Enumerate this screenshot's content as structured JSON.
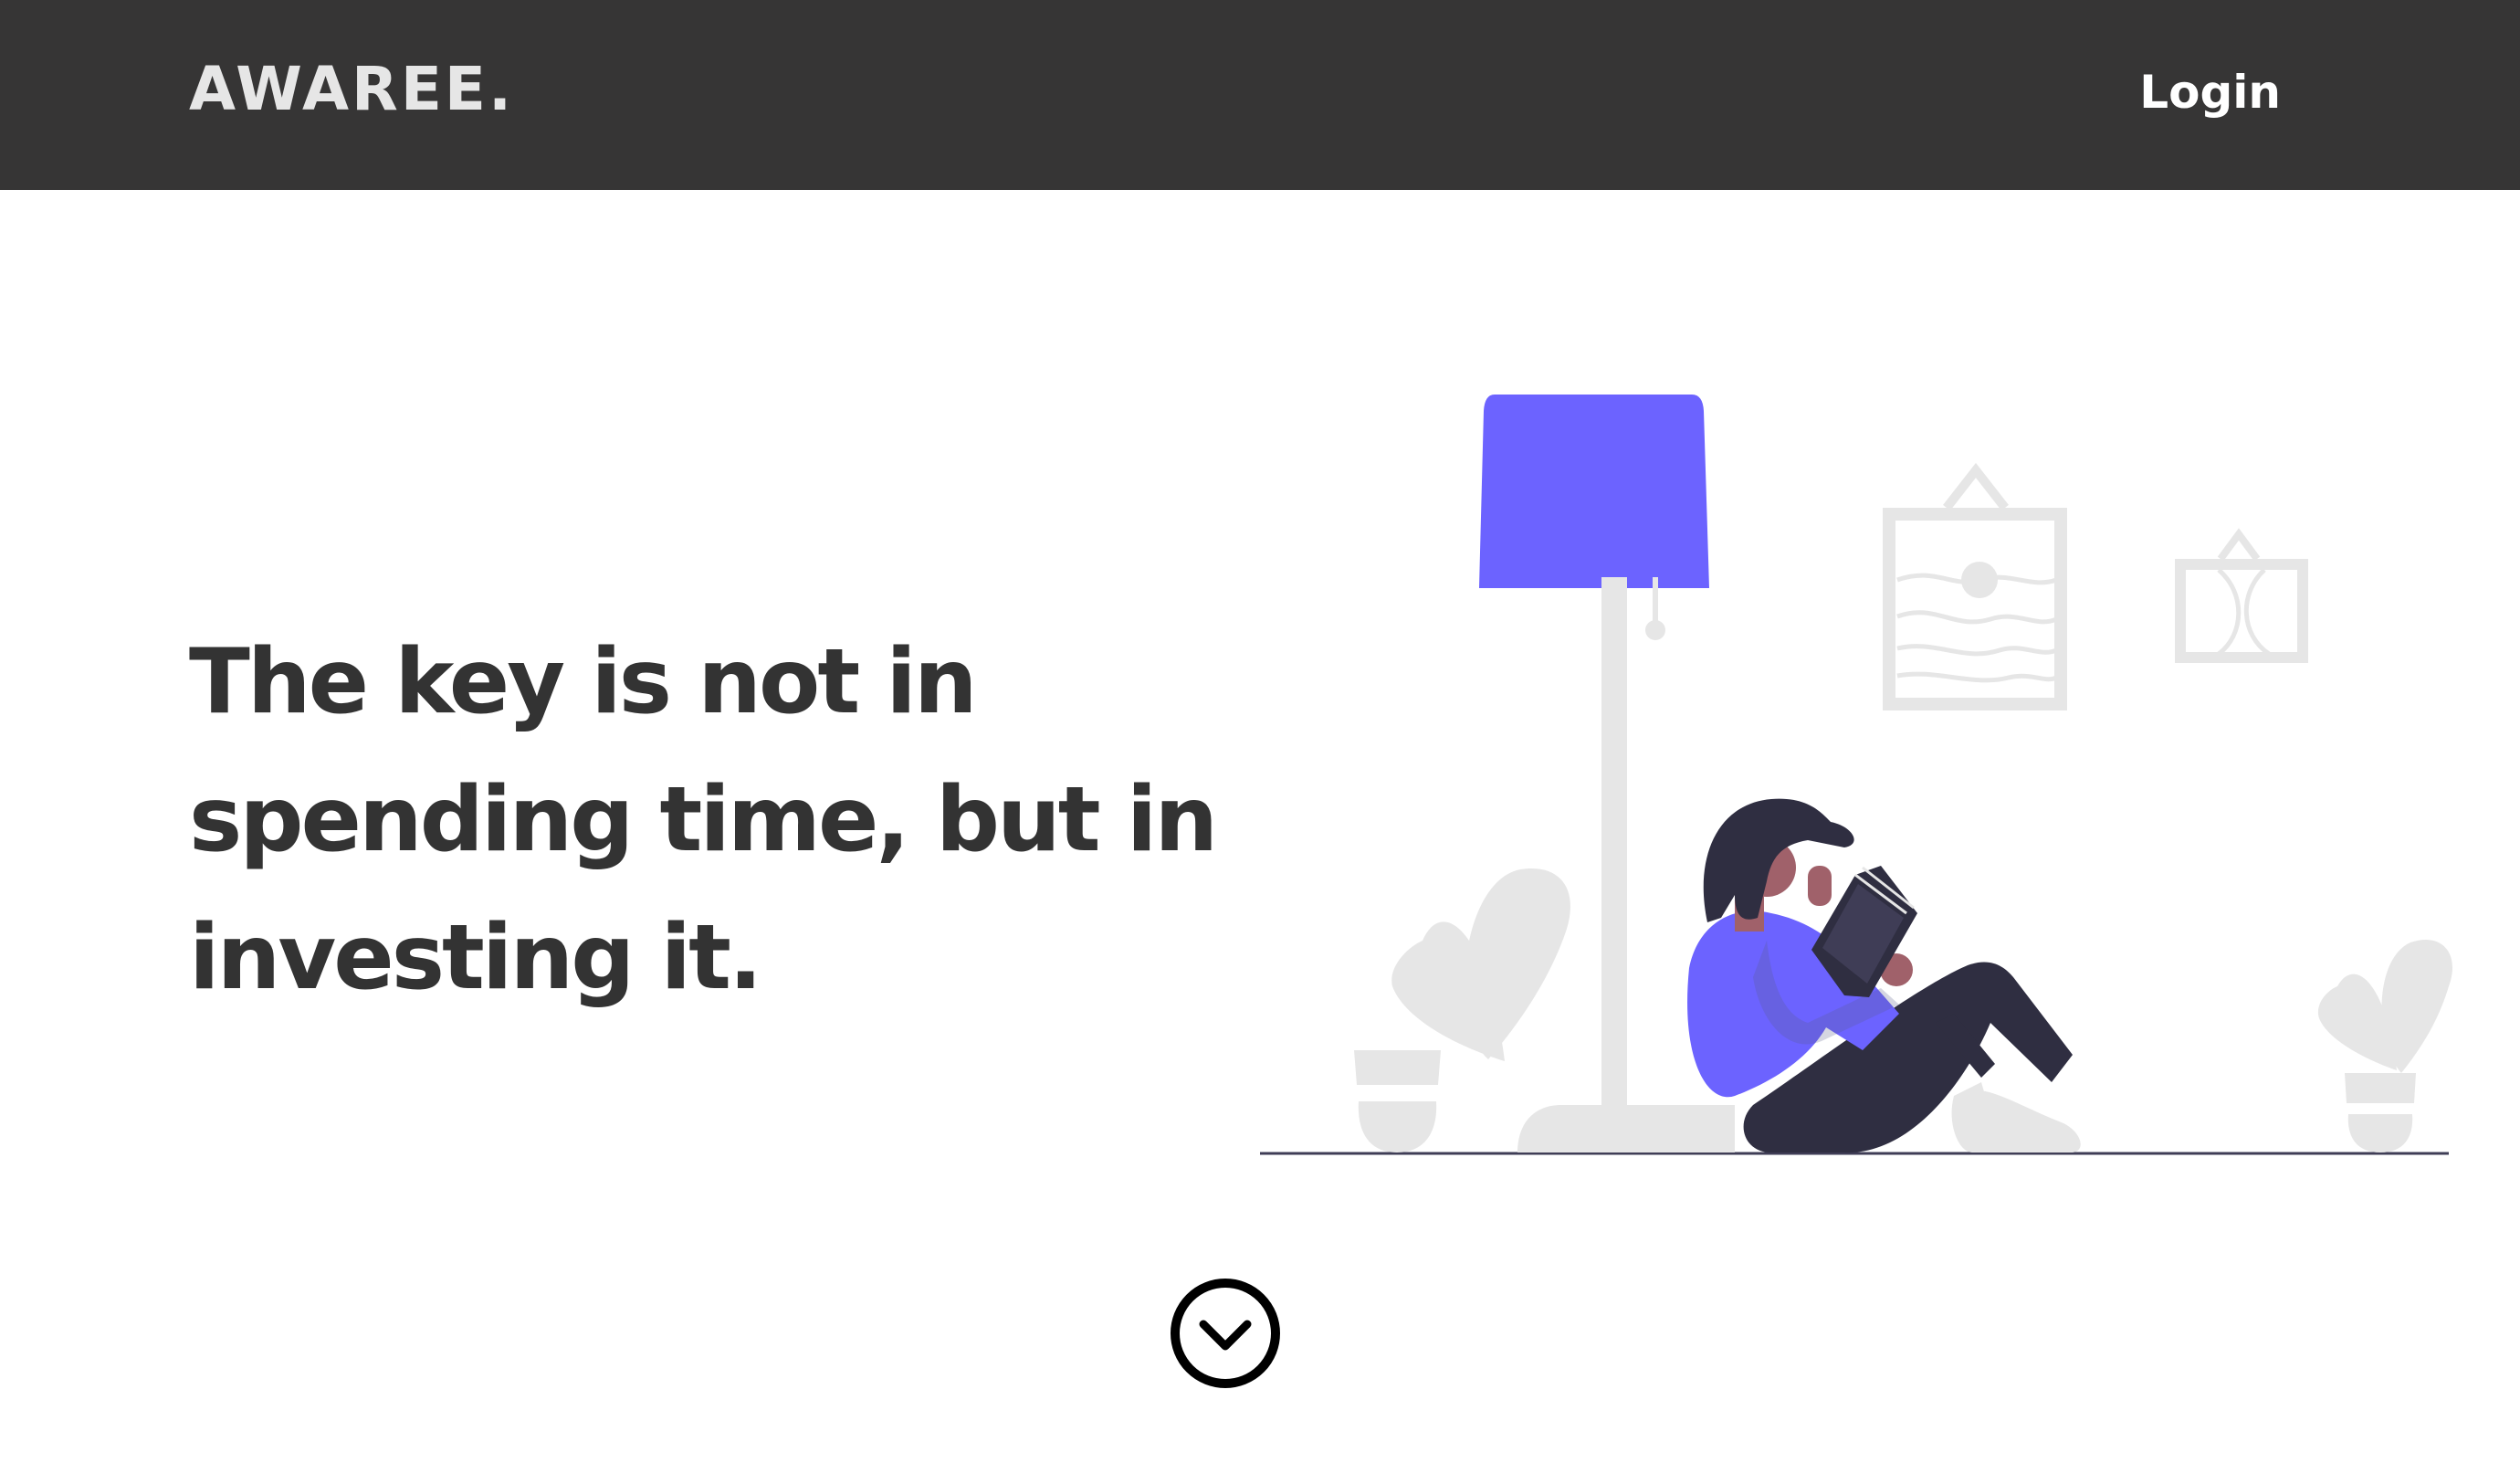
{
  "header": {
    "brand": "AWAREE.",
    "login_label": "Login",
    "background": "#363535"
  },
  "hero": {
    "headline_lines": [
      "The key is not in",
      "spending time, but in",
      "investing it."
    ]
  },
  "illustration": {
    "subject": "woman reading book under floor lamp",
    "accent_color": "#6c63ff",
    "neutral_color": "#e6e6e6",
    "dark_color": "#2f2e41"
  },
  "scroll_indicator": {
    "icon": "chevron-down-icon"
  }
}
